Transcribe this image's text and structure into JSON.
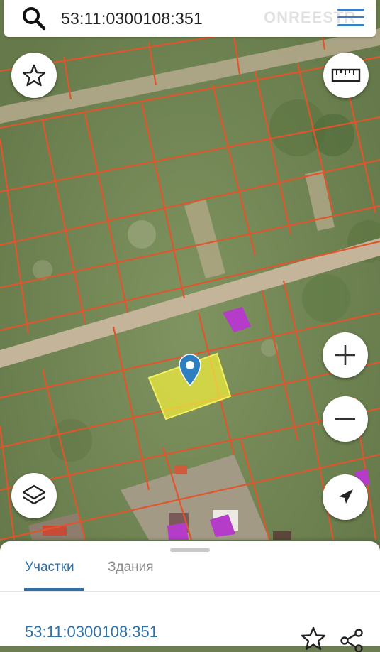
{
  "search": {
    "query": "53:11:0300108:351"
  },
  "watermark": "ONREESTR",
  "controls": {
    "favorites": "star-icon",
    "ruler": "ruler-icon",
    "zoom_in": "plus-icon",
    "zoom_out": "minus-icon",
    "layers": "layers-icon",
    "locate": "navigation-arrow-icon"
  },
  "sheet": {
    "tabs": [
      {
        "label": "Участки",
        "active": true
      },
      {
        "label": "Здания",
        "active": false
      }
    ],
    "parcel_number": "53:11:0300108:351"
  },
  "colors": {
    "accent": "#2e6fa6",
    "boundary": "#e2552c",
    "selected_parcel": "#f2ef3e",
    "building": "#b43cc8",
    "map_pin": "#2e7fc0"
  }
}
